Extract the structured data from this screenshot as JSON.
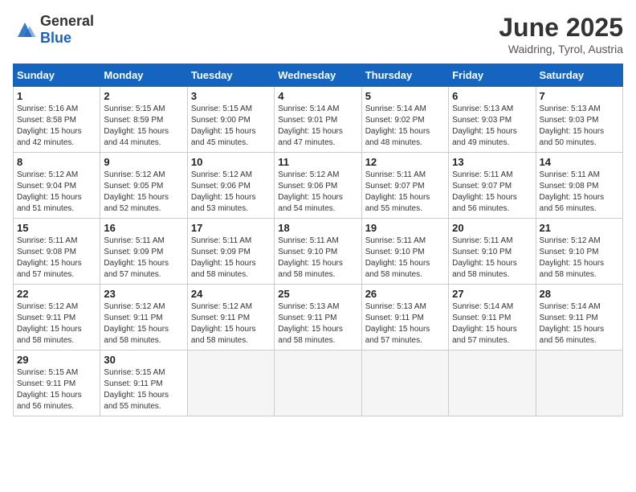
{
  "logo": {
    "general": "General",
    "blue": "Blue"
  },
  "header": {
    "month": "June 2025",
    "location": "Waidring, Tyrol, Austria"
  },
  "weekdays": [
    "Sunday",
    "Monday",
    "Tuesday",
    "Wednesday",
    "Thursday",
    "Friday",
    "Saturday"
  ],
  "weeks": [
    [
      {
        "day": 1,
        "sunrise": "5:16 AM",
        "sunset": "8:58 PM",
        "daylight": "15 hours and 42 minutes."
      },
      {
        "day": 2,
        "sunrise": "5:15 AM",
        "sunset": "8:59 PM",
        "daylight": "15 hours and 44 minutes."
      },
      {
        "day": 3,
        "sunrise": "5:15 AM",
        "sunset": "9:00 PM",
        "daylight": "15 hours and 45 minutes."
      },
      {
        "day": 4,
        "sunrise": "5:14 AM",
        "sunset": "9:01 PM",
        "daylight": "15 hours and 47 minutes."
      },
      {
        "day": 5,
        "sunrise": "5:14 AM",
        "sunset": "9:02 PM",
        "daylight": "15 hours and 48 minutes."
      },
      {
        "day": 6,
        "sunrise": "5:13 AM",
        "sunset": "9:03 PM",
        "daylight": "15 hours and 49 minutes."
      },
      {
        "day": 7,
        "sunrise": "5:13 AM",
        "sunset": "9:03 PM",
        "daylight": "15 hours and 50 minutes."
      }
    ],
    [
      {
        "day": 8,
        "sunrise": "5:12 AM",
        "sunset": "9:04 PM",
        "daylight": "15 hours and 51 minutes."
      },
      {
        "day": 9,
        "sunrise": "5:12 AM",
        "sunset": "9:05 PM",
        "daylight": "15 hours and 52 minutes."
      },
      {
        "day": 10,
        "sunrise": "5:12 AM",
        "sunset": "9:06 PM",
        "daylight": "15 hours and 53 minutes."
      },
      {
        "day": 11,
        "sunrise": "5:12 AM",
        "sunset": "9:06 PM",
        "daylight": "15 hours and 54 minutes."
      },
      {
        "day": 12,
        "sunrise": "5:11 AM",
        "sunset": "9:07 PM",
        "daylight": "15 hours and 55 minutes."
      },
      {
        "day": 13,
        "sunrise": "5:11 AM",
        "sunset": "9:07 PM",
        "daylight": "15 hours and 56 minutes."
      },
      {
        "day": 14,
        "sunrise": "5:11 AM",
        "sunset": "9:08 PM",
        "daylight": "15 hours and 56 minutes."
      }
    ],
    [
      {
        "day": 15,
        "sunrise": "5:11 AM",
        "sunset": "9:08 PM",
        "daylight": "15 hours and 57 minutes."
      },
      {
        "day": 16,
        "sunrise": "5:11 AM",
        "sunset": "9:09 PM",
        "daylight": "15 hours and 57 minutes."
      },
      {
        "day": 17,
        "sunrise": "5:11 AM",
        "sunset": "9:09 PM",
        "daylight": "15 hours and 58 minutes."
      },
      {
        "day": 18,
        "sunrise": "5:11 AM",
        "sunset": "9:10 PM",
        "daylight": "15 hours and 58 minutes."
      },
      {
        "day": 19,
        "sunrise": "5:11 AM",
        "sunset": "9:10 PM",
        "daylight": "15 hours and 58 minutes."
      },
      {
        "day": 20,
        "sunrise": "5:11 AM",
        "sunset": "9:10 PM",
        "daylight": "15 hours and 58 minutes."
      },
      {
        "day": 21,
        "sunrise": "5:12 AM",
        "sunset": "9:10 PM",
        "daylight": "15 hours and 58 minutes."
      }
    ],
    [
      {
        "day": 22,
        "sunrise": "5:12 AM",
        "sunset": "9:11 PM",
        "daylight": "15 hours and 58 minutes."
      },
      {
        "day": 23,
        "sunrise": "5:12 AM",
        "sunset": "9:11 PM",
        "daylight": "15 hours and 58 minutes."
      },
      {
        "day": 24,
        "sunrise": "5:12 AM",
        "sunset": "9:11 PM",
        "daylight": "15 hours and 58 minutes."
      },
      {
        "day": 25,
        "sunrise": "5:13 AM",
        "sunset": "9:11 PM",
        "daylight": "15 hours and 58 minutes."
      },
      {
        "day": 26,
        "sunrise": "5:13 AM",
        "sunset": "9:11 PM",
        "daylight": "15 hours and 57 minutes."
      },
      {
        "day": 27,
        "sunrise": "5:14 AM",
        "sunset": "9:11 PM",
        "daylight": "15 hours and 57 minutes."
      },
      {
        "day": 28,
        "sunrise": "5:14 AM",
        "sunset": "9:11 PM",
        "daylight": "15 hours and 56 minutes."
      }
    ],
    [
      {
        "day": 29,
        "sunrise": "5:15 AM",
        "sunset": "9:11 PM",
        "daylight": "15 hours and 56 minutes."
      },
      {
        "day": 30,
        "sunrise": "5:15 AM",
        "sunset": "9:11 PM",
        "daylight": "15 hours and 55 minutes."
      },
      null,
      null,
      null,
      null,
      null
    ]
  ]
}
